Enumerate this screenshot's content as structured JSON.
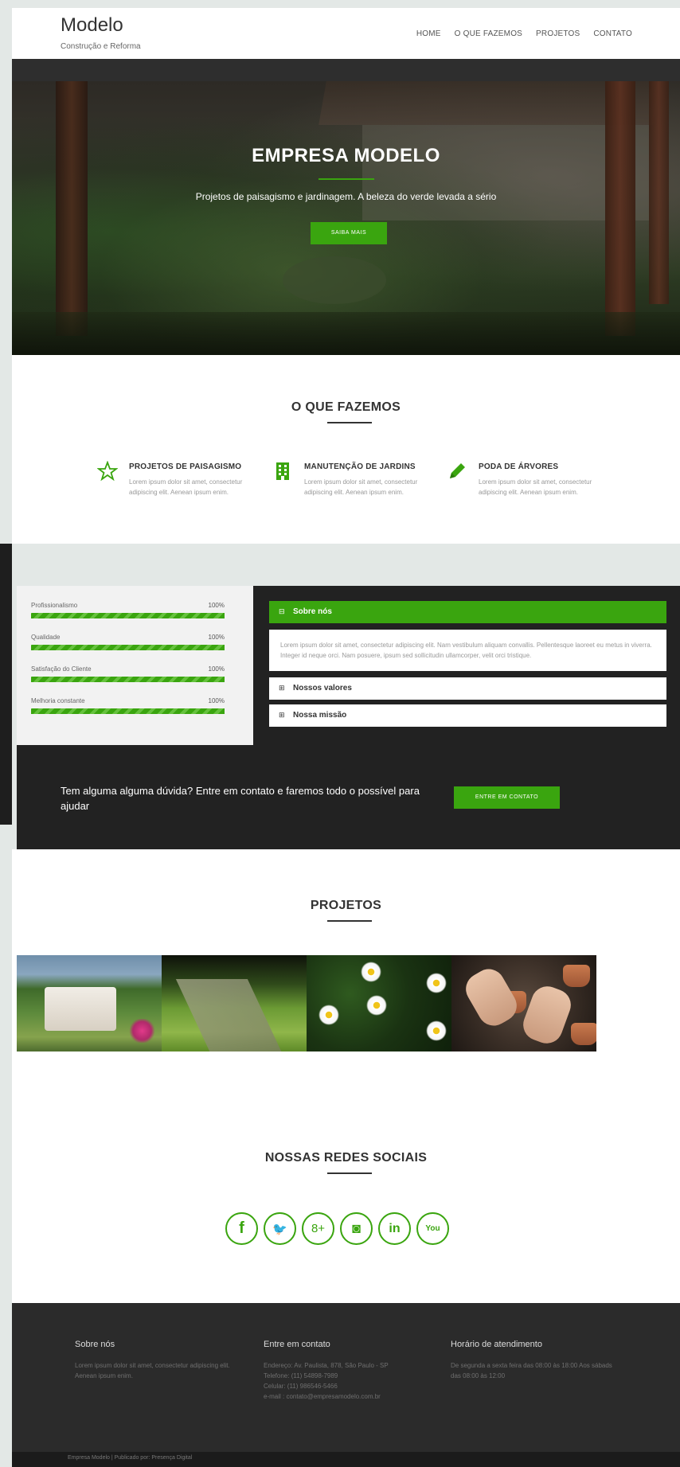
{
  "header": {
    "logo_title": "Modelo",
    "logo_subtitle": "Construção e Reforma",
    "nav": [
      "HOME",
      "O QUE FAZEMOS",
      "PROJETOS",
      "CONTATO"
    ]
  },
  "hero": {
    "title": "EMPRESA MODELO",
    "subtitle": "Projetos de paisagismo e jardinagem. A beleza do verde levada a sério",
    "button": "SAIBA MAIS"
  },
  "services": {
    "title": "O QUE FAZEMOS",
    "items": [
      {
        "title": "PROJETOS DE PAISAGISMO",
        "text": "Lorem ipsum dolor sit amet, consectetur adipiscing elit. Aenean ipsum enim.",
        "icon": "star-icon"
      },
      {
        "title": "MANUTENÇÃO DE JARDINS",
        "text": "Lorem ipsum dolor sit amet, consectetur adipiscing elit. Aenean ipsum enim.",
        "icon": "building-icon"
      },
      {
        "title": "PODA DE ÁRVORES",
        "text": "Lorem ipsum dolor sit amet, consectetur adipiscing elit. Aenean ipsum enim.",
        "icon": "pencil-icon"
      }
    ]
  },
  "skills": [
    {
      "label": "Profissionalismo",
      "value": "100%",
      "fraction": 1.0
    },
    {
      "label": "Qualidade",
      "value": "100%",
      "fraction": 1.0
    },
    {
      "label": "Satisfação do Cliente",
      "value": "100%",
      "fraction": 1.0
    },
    {
      "label": "Melhoria constante",
      "value": "100%",
      "fraction": 1.0
    }
  ],
  "accordion": [
    {
      "label": "Sobre nós",
      "icon_char": "⊟",
      "expanded": true,
      "body": "Lorem ipsum dolor sit amet, consectetur adipiscing elit. Nam vestibulum aliquam convallis. Pellentesque laoreet eu metus in viverra. Integer id neque orci. Nam posuere, ipsum sed sollicitudin ullamcorper, velit orci tristique."
    },
    {
      "label": "Nossos valores",
      "icon_char": "⊞",
      "expanded": false
    },
    {
      "label": "Nossa missão",
      "icon_char": "⊞",
      "expanded": false
    }
  ],
  "cta": {
    "text": "Tem alguma alguma dúvida? Entre em contato e faremos todo o possível para ajudar",
    "button": "ENTRE EM CONTATO"
  },
  "projects": {
    "title": "PROJETOS"
  },
  "social": {
    "title": "NOSSAS REDES SOCIAIS",
    "icons": [
      {
        "name": "facebook-icon",
        "glyph": "f"
      },
      {
        "name": "twitter-icon",
        "glyph": "🐦"
      },
      {
        "name": "google-plus-icon",
        "glyph": "8+"
      },
      {
        "name": "instagram-icon",
        "glyph": "◙"
      },
      {
        "name": "linkedin-icon",
        "glyph": "in"
      },
      {
        "name": "youtube-icon",
        "glyph": "You"
      }
    ]
  },
  "footer": {
    "about_title": "Sobre nós",
    "about_text": "Lorem ipsum dolor sit amet, consectetur adipiscing elit. Aenean ipsum enim.",
    "contact_title": "Entre em contato",
    "contact_lines": [
      "Endereço: Av. Paulista, 878, São Paulo - SP",
      "Telefone: (11) 54898-7989",
      "Celular: (11) 986546-5466",
      "e-mail : contato@empresamodelo.com.br"
    ],
    "hours_title": "Horário de atendimento",
    "hours_text": "De segunda a sexta feira das 08:00 às 18:00 Aos sábads das 08:00 às 12:00",
    "bottom": "Empresa Modelo | Publicado por: Presença Digital"
  },
  "colors": {
    "accent": "#3aa50f",
    "dark": "#222222",
    "footer": "#2b2b2b"
  }
}
